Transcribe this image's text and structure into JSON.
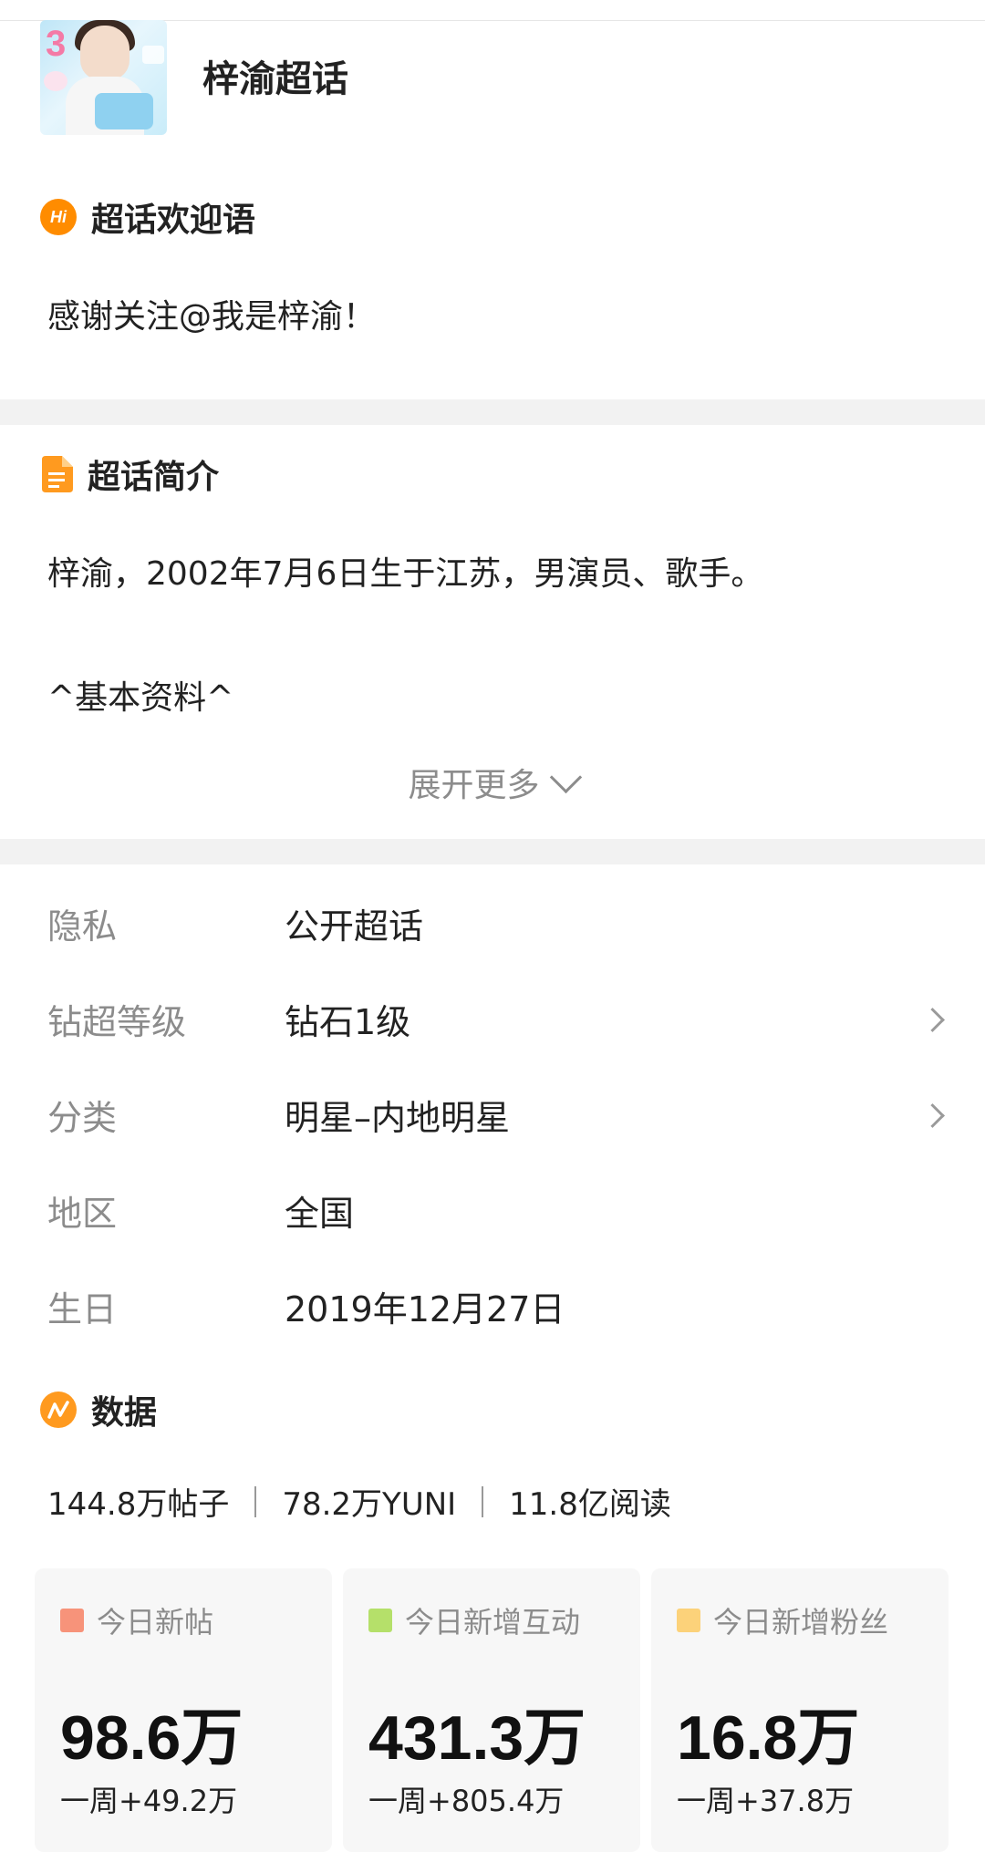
{
  "header": {
    "title": "梓渝超话"
  },
  "welcome": {
    "section_title": "超话欢迎语",
    "icon_text": "Hi",
    "text": "感谢关注@我是梓渝！"
  },
  "intro": {
    "section_title": "超话简介",
    "line1": "梓渝，2002年7月6日生于江苏，男演员、歌手。",
    "line2": "^基本资料^",
    "expand_label": "展开更多"
  },
  "info": {
    "rows": [
      {
        "label": "隐私",
        "value": "公开超话",
        "arrow": false
      },
      {
        "label": "钻超等级",
        "value": "钻石1级",
        "arrow": true
      },
      {
        "label": "分类",
        "value": "明星–内地明星",
        "arrow": true
      },
      {
        "label": "地区",
        "value": "全国",
        "arrow": false
      },
      {
        "label": "生日",
        "value": "2019年12月27日",
        "arrow": false
      }
    ]
  },
  "data": {
    "section_title": "数据",
    "stats": [
      "144.8万帖子",
      "78.2万YUNI",
      "11.8亿阅读"
    ],
    "cards": [
      {
        "label": "今日新帖",
        "value": "98.6万",
        "week": "一周+49.2万",
        "color": "#f7937a"
      },
      {
        "label": "今日新增互动",
        "value": "431.3万",
        "week": "一周+805.4万",
        "color": "#b5e06a"
      },
      {
        "label": "今日新增粉丝",
        "value": "16.8万",
        "week": "一周+37.8万",
        "color": "#fcd27a"
      }
    ]
  },
  "colors": {
    "accent": "#ff8c00",
    "gap": "#f2f2f2",
    "muted": "#8c8c8c"
  }
}
